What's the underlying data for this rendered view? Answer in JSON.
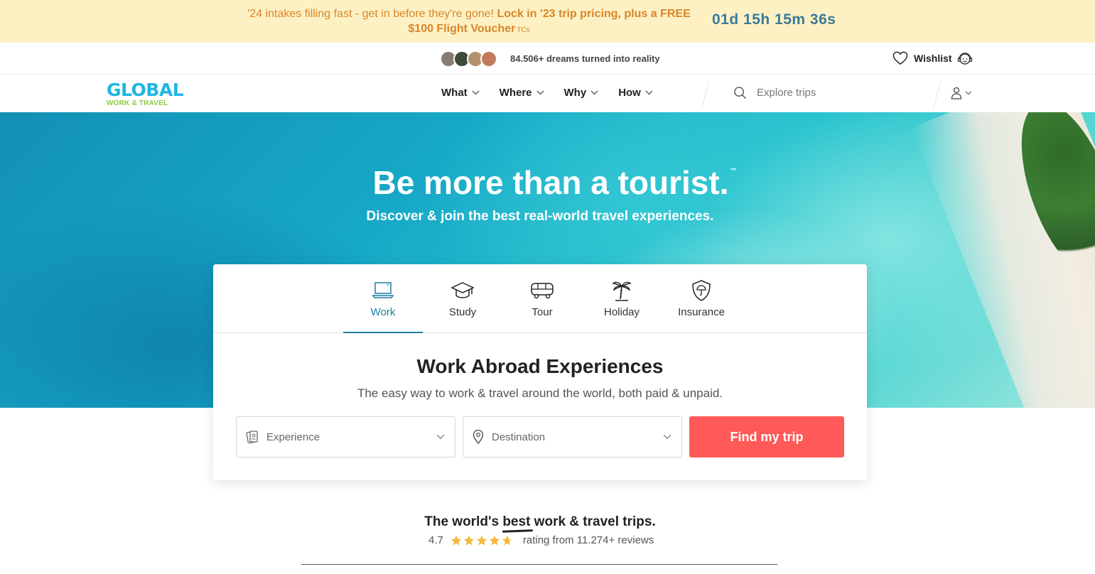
{
  "promo": {
    "text_regular": "'24 intakes filling fast - get in before they're gone! ",
    "text_bold": "Lock in '23 trip pricing, plus a FREE $100 Flight Voucher",
    "tcs": "TCs",
    "countdown": "01d 15h 15m 36s"
  },
  "topbar": {
    "social_proof": "84.506+ dreams turned into reality",
    "wishlist_label": "Wishlist",
    "avatar_colors": [
      "#8a7b6e",
      "#3d4a3a",
      "#b0906e",
      "#c27a5e"
    ]
  },
  "nav": {
    "links": [
      {
        "label": "What"
      },
      {
        "label": "Where"
      },
      {
        "label": "Why"
      },
      {
        "label": "How"
      }
    ],
    "search_placeholder": "Explore trips",
    "logo_top": "GLOBAL",
    "logo_bottom": "WORK & TRAVEL"
  },
  "hero": {
    "title": "Be more than a tourist.",
    "title_mark": "™",
    "subtitle": "Discover & join the best real-world travel experiences."
  },
  "search_card": {
    "tabs": [
      {
        "label": "Work",
        "icon": "laptop-icon",
        "active": true
      },
      {
        "label": "Study",
        "icon": "graduation-cap-icon",
        "active": false
      },
      {
        "label": "Tour",
        "icon": "bus-icon",
        "active": false
      },
      {
        "label": "Holiday",
        "icon": "palm-tree-icon",
        "active": false
      },
      {
        "label": "Insurance",
        "icon": "shield-umbrella-icon",
        "active": false
      }
    ],
    "title": "Work Abroad Experiences",
    "subtitle": "The easy way to work & travel around the world, both paid & unpaid.",
    "experience_placeholder": "Experience",
    "destination_placeholder": "Destination",
    "find_button": "Find my trip"
  },
  "rating": {
    "tagline_pre": "The world's ",
    "tagline_best": "best",
    "tagline_post": " work & travel trips.",
    "score": "4.7",
    "stars": 4.7,
    "reviews": "rating from 11.274+ reviews"
  },
  "colors": {
    "accent": "#1b7fa0",
    "cta": "#ff5a57",
    "promo_bg": "#fdf1c4",
    "promo_text": "#d9852a",
    "countdown": "#3a7a9a",
    "star": "#f5b83d"
  }
}
